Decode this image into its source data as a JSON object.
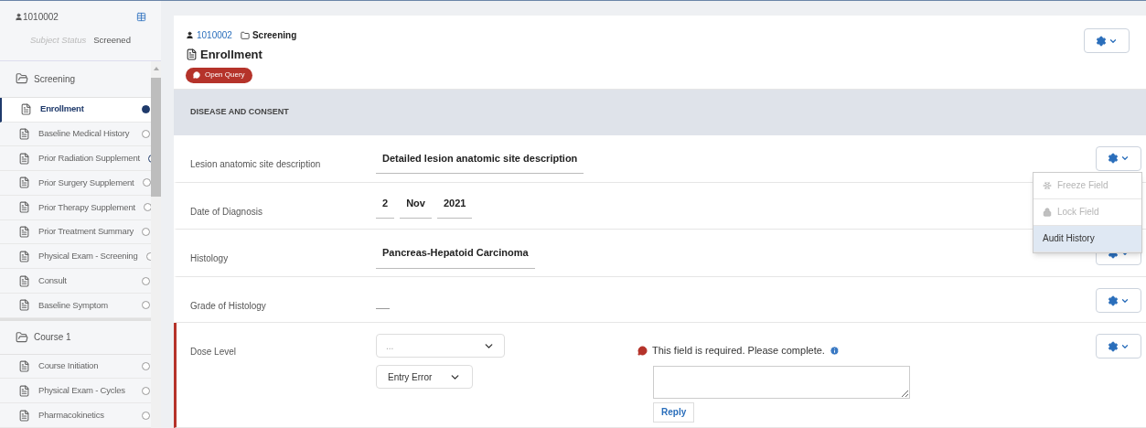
{
  "subject": {
    "id": "1010002",
    "status_label": "Subject Status",
    "status": "Screened"
  },
  "sidebar": {
    "groups": [
      {
        "name": "Screening",
        "items": [
          {
            "kind": "complete",
            "label": "Enrollment",
            "selected": true
          },
          {
            "kind": "empty",
            "label": "Baseline Medical History",
            "selected": false
          },
          {
            "kind": "partial",
            "label": "Prior Radiation Supplement",
            "selected": false
          },
          {
            "kind": "empty",
            "label": "Prior Surgery Supplement",
            "selected": false
          },
          {
            "kind": "empty",
            "label": "Prior Therapy Supplement",
            "selected": false
          },
          {
            "kind": "empty",
            "label": "Prior Treatment Summary",
            "selected": false
          },
          {
            "kind": "empty",
            "label": "Physical Exam - Screening",
            "selected": false
          },
          {
            "kind": "empty",
            "label": "Consult",
            "selected": false
          },
          {
            "kind": "empty",
            "label": "Baseline Symptom",
            "selected": false
          }
        ]
      },
      {
        "name": "Course 1",
        "items": [
          {
            "kind": "empty",
            "label": "Course Initiation",
            "selected": false
          },
          {
            "kind": "empty",
            "label": "Physical Exam - Cycles",
            "selected": false
          },
          {
            "kind": "empty",
            "label": "Pharmacokinetics",
            "selected": false
          }
        ]
      }
    ]
  },
  "header": {
    "subject_link": "1010002",
    "folder": "Screening",
    "form_title": "Enrollment",
    "badge": "Open Query"
  },
  "section": {
    "title": "DISEASE AND CONSENT"
  },
  "rows": [
    {
      "kind": "text",
      "label": "Lesion anatomic site description",
      "value": "Detailed lesion anatomic site description",
      "flagged": false,
      "gear": true,
      "menu": [
        {
          "kind": "freeze",
          "label": "Freeze Field",
          "disabled": true,
          "selected": false
        },
        {
          "kind": "lock",
          "label": "Lock Field",
          "disabled": true,
          "selected": false
        },
        {
          "kind": "plain",
          "label": "Audit History",
          "disabled": false,
          "selected": true
        }
      ]
    },
    {
      "kind": "date",
      "label": "Date of Diagnosis",
      "parts": [
        "2",
        "Nov",
        "2021"
      ],
      "flagged": false,
      "gear": false
    },
    {
      "kind": "text",
      "label": "Histology",
      "value": "Pancreas-Hepatoid Carcinoma",
      "flagged": false,
      "gear": true
    },
    {
      "kind": "empty",
      "label": "Grade of Histology",
      "flagged": false,
      "gear": true
    },
    {
      "kind": "select",
      "label": "Dose Level",
      "placeholder": "...",
      "reason": "Entry Error",
      "flagged": true,
      "gear": true,
      "query": {
        "message": "This field is required. Please complete.",
        "button": "Reply"
      }
    }
  ]
}
